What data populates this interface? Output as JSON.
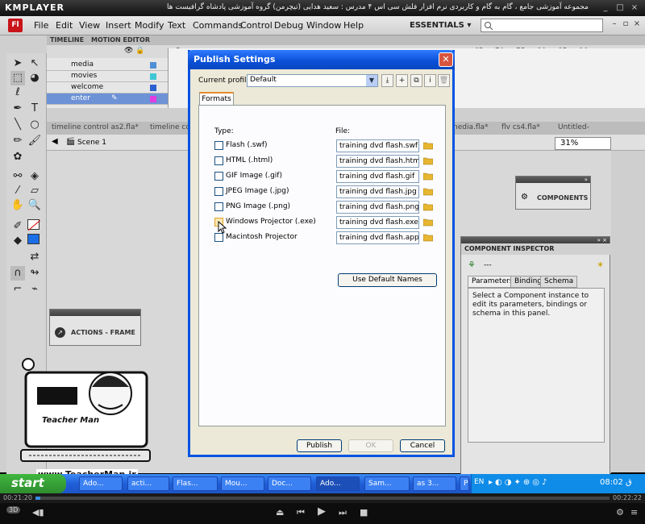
{
  "player": {
    "name": "KMPLAYER",
    "title": "مجموعه آموزشی جامع ، گام به گام و کاربردی نرم افزار فلش سی اس ۴ مدرس : سعید هدایی (تیچرمن) گروه آموزشی پادشاه گرافیست ها",
    "time_elapsed": "00:21:20",
    "time_total": "00:22:22"
  },
  "flash": {
    "logo": "Fl",
    "menu": [
      "File",
      "Edit",
      "View",
      "Insert",
      "Modify",
      "Text",
      "Commands",
      "Control",
      "Debug",
      "Window",
      "Help"
    ],
    "workspace": "ESSENTIALS",
    "timeline_tabs": [
      "TIMELINE",
      "MOTION EDITOR"
    ],
    "layers": [
      {
        "name": "media"
      },
      {
        "name": "movies"
      },
      {
        "name": "welcome"
      },
      {
        "name": "enter"
      }
    ],
    "frame_numbers": [
      "5",
      "65",
      "70",
      "75",
      "80",
      "85",
      "90"
    ],
    "doc_tabs": [
      "timeline control as2.fla*",
      "timeline co",
      "nedia.fla*",
      "flv cs4.fla*",
      "Untitled-"
    ],
    "scene": "Scene 1",
    "zoom": "31%"
  },
  "panels": {
    "actions": "ACTIONS - FRAME",
    "components": "COMPONENTS",
    "inspector": {
      "title": "COMPONENT INSPECTOR",
      "instance": "---",
      "tabs": [
        "Parameters",
        "Bindings",
        "Schema"
      ],
      "message": "Select a Component instance to edit its parameters, bindings or schema in this panel."
    }
  },
  "dialog": {
    "title": "Publish Settings",
    "profile_label": "Current profile:",
    "profile_value": "Default",
    "tab": "Formats",
    "type_header": "Type:",
    "file_header": "File:",
    "formats": [
      {
        "label": "Flash  (.swf)",
        "file": "training dvd flash.swf",
        "checked": false
      },
      {
        "label": "HTML  (.html)",
        "file": "training dvd flash.html",
        "checked": false
      },
      {
        "label": "GIF Image  (.gif)",
        "file": "training dvd flash.gif",
        "checked": false
      },
      {
        "label": "JPEG Image  (.jpg)",
        "file": "training dvd flash.jpg",
        "checked": false
      },
      {
        "label": "PNG Image  (.png)",
        "file": "training dvd flash.png",
        "checked": false
      },
      {
        "label": "Windows Projector  (.exe)",
        "file": "training dvd flash.exe",
        "checked": false
      },
      {
        "label": "Macintosh Projector",
        "file": "training dvd flash.app",
        "checked": false
      }
    ],
    "default_names": "Use Default Names",
    "publish": "Publish",
    "ok": "OK",
    "cancel": "Cancel"
  },
  "watermark": {
    "name": "Teacher Man",
    "url": "www.TeacherMan.ir"
  },
  "taskbar": {
    "start": "start",
    "tasks": [
      "Ado...",
      "acti...",
      "Flas...",
      "Mou...",
      "Doc...",
      "Ado...",
      "Sam...",
      "as 3...",
      "PNG..."
    ],
    "lang": "EN",
    "clock": "08:02 ق"
  },
  "colors": {
    "xp_blue": "#0054e3",
    "flash_red": "#c8141a",
    "layer_select": "#6d92d6"
  }
}
